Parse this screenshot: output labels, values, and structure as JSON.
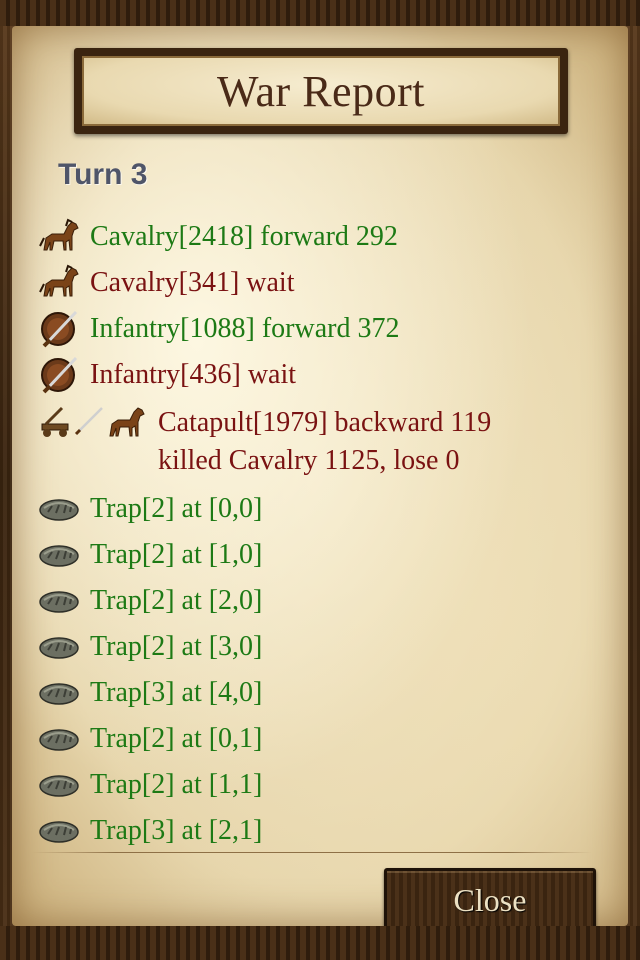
{
  "header": {
    "title": "War Report"
  },
  "turn_label": "Turn 3",
  "entries": [
    {
      "icon": "horse-icon",
      "text": "Cavalry[2418] forward 292",
      "color": "green"
    },
    {
      "icon": "horse-icon",
      "text": "Cavalry[341] wait",
      "color": "red"
    },
    {
      "icon": "shield-sword-icon",
      "text": "Infantry[1088] forward 372",
      "color": "green"
    },
    {
      "icon": "shield-sword-icon",
      "text": "Infantry[436] wait",
      "color": "red"
    },
    {
      "icon": "catapult-attack-horse-icon",
      "text": "Catapult[1979] backward 119",
      "text2": "killed Cavalry 1125, lose 0",
      "color": "red"
    },
    {
      "icon": "trap-icon",
      "text": "Trap[2] at [0,0]",
      "color": "green"
    },
    {
      "icon": "trap-icon",
      "text": "Trap[2] at [1,0]",
      "color": "green"
    },
    {
      "icon": "trap-icon",
      "text": "Trap[2] at [2,0]",
      "color": "green"
    },
    {
      "icon": "trap-icon",
      "text": "Trap[2] at [3,0]",
      "color": "green"
    },
    {
      "icon": "trap-icon",
      "text": "Trap[3] at [4,0]",
      "color": "green"
    },
    {
      "icon": "trap-icon",
      "text": "Trap[2] at [0,1]",
      "color": "green"
    },
    {
      "icon": "trap-icon",
      "text": "Trap[2] at [1,1]",
      "color": "green"
    },
    {
      "icon": "trap-icon",
      "text": "Trap[3] at [2,1]",
      "color": "green"
    }
  ],
  "close_label": "Close",
  "colors": {
    "green_text": "#1d7a15",
    "red_text": "#7a1212",
    "turn_text": "#4f5569"
  }
}
